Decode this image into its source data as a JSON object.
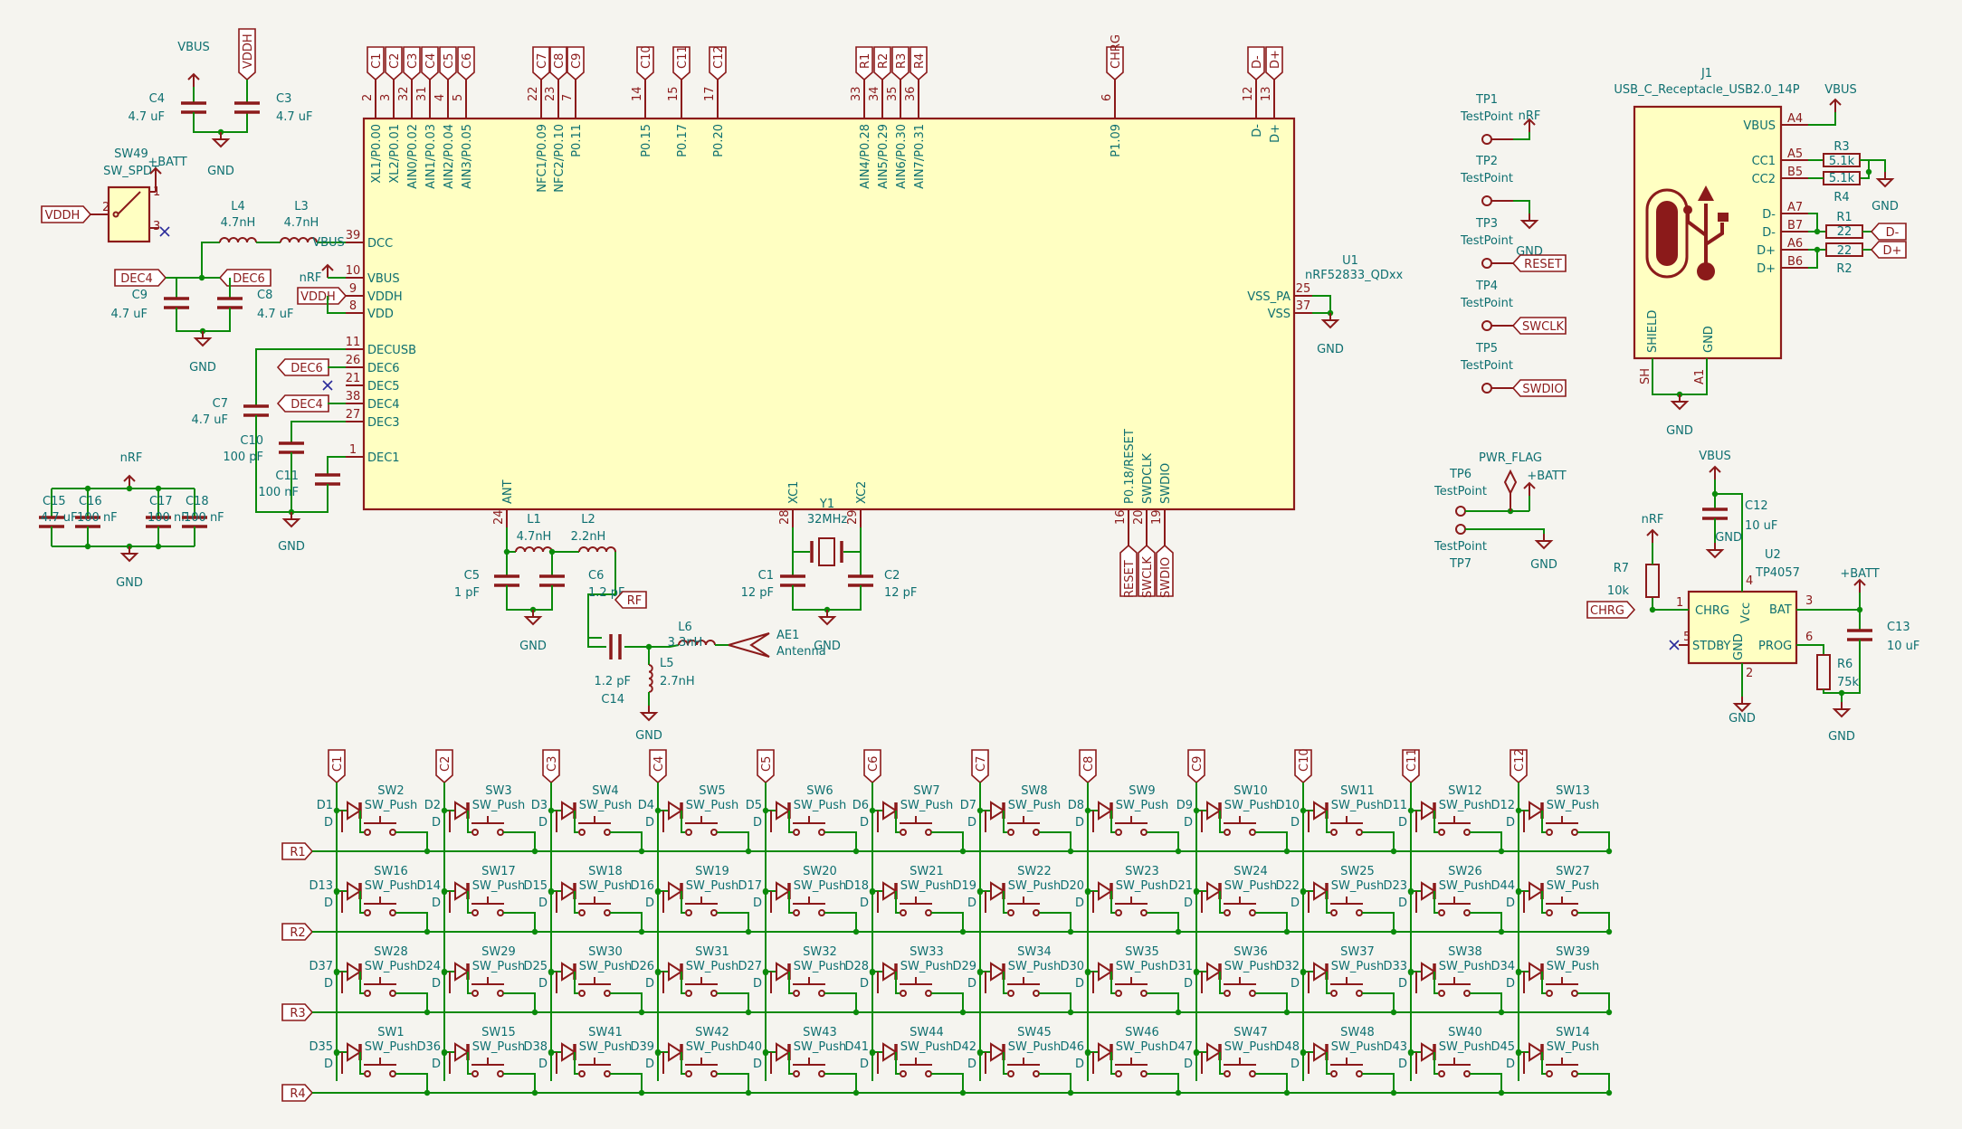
{
  "mcu": {
    "ref": "U1",
    "value": "nRF52833_QDxx",
    "top": [
      [
        "2",
        "XL1/P0.00",
        "C1"
      ],
      [
        "3",
        "XL2/P0.01",
        "C2"
      ],
      [
        "32",
        "AIN0/P0.02",
        "C3"
      ],
      [
        "31",
        "AIN1/P0.03",
        "C4"
      ],
      [
        "4",
        "AIN2/P0.04",
        "C5"
      ],
      [
        "5",
        "AIN3/P0.05",
        "C6"
      ],
      [
        "22",
        "NFC1/P0.09",
        "C7"
      ],
      [
        "23",
        "NFC2/P0.10",
        "C8"
      ],
      [
        "7",
        "P0.11",
        "C9"
      ],
      [
        "14",
        "P0.15",
        "C10"
      ],
      [
        "15",
        "P0.17",
        "C11"
      ],
      [
        "17",
        "P0.20",
        "C12"
      ],
      [
        "33",
        "AIN4/P0.28",
        "R1"
      ],
      [
        "34",
        "AIN5/P0.29",
        "R2"
      ],
      [
        "35",
        "AIN6/P0.30",
        "R3"
      ],
      [
        "36",
        "AIN7/P0.31",
        "R4"
      ],
      [
        "6",
        "P1.09",
        "CHRG"
      ],
      [
        "12",
        "D-",
        "D-"
      ],
      [
        "13",
        "D+",
        "D+"
      ]
    ],
    "left": [
      [
        "39",
        "DCC"
      ],
      [
        "10",
        "VBUS"
      ],
      [
        "9",
        "VDDH"
      ],
      [
        "8",
        "VDD"
      ],
      [
        "11",
        "DECUSB"
      ],
      [
        "26",
        "DEC6"
      ],
      [
        "21",
        "DEC5"
      ],
      [
        "38",
        "DEC4"
      ],
      [
        "27",
        "DEC3"
      ],
      [
        "1",
        "DEC1"
      ]
    ],
    "right": [
      [
        "25",
        "VSS_PA"
      ],
      [
        "37",
        "VSS"
      ]
    ],
    "bottom": [
      [
        "24",
        "ANT"
      ],
      [
        "28",
        "XC1"
      ],
      [
        "29",
        "XC2"
      ],
      [
        "16",
        "P0.18/RESET"
      ],
      [
        "20",
        "SWDCLK"
      ],
      [
        "19",
        "SWDIO"
      ]
    ],
    "swd_labels": [
      "RESET",
      "SWCLK",
      "SWDIO"
    ]
  },
  "power": {
    "C4": "C4",
    "C4v": "4.7 uF",
    "C3": "C3",
    "C3v": "4.7 uF",
    "vbus": "VBUS",
    "vddh": "VDDH",
    "gnd": "GND"
  },
  "switch": {
    "ref": "SW49",
    "value": "SW_SPDT",
    "batt": "+BATT",
    "vddh": "VDDH",
    "p1": "1",
    "p2": "2",
    "p3": "3"
  },
  "dcdc": {
    "L4": "L4",
    "L4v": "4.7nH",
    "L3": "L3",
    "L3v": "4.7nH",
    "vbus": "VBUS",
    "nrf": "nRF",
    "vddh": "VDDH",
    "dec4": "DEC4",
    "dec6": "DEC6",
    "C9": "C9",
    "C9v": "4.7 uF",
    "C8": "C8",
    "C8v": "4.7 uF",
    "gnd": "GND"
  },
  "decoup": {
    "C7": "C7",
    "C7v": "4.7 uF",
    "C10": "C10",
    "C10v": "100 pF",
    "C11": "C11",
    "C11v": "100 nF",
    "dec6": "DEC6",
    "dec4": "DEC4",
    "gnd": "GND"
  },
  "bulk": {
    "net": "nRF",
    "gnd": "GND",
    "caps": [
      [
        "C15",
        "4.7 uF"
      ],
      [
        "C16",
        "100 nF"
      ],
      [
        "C17",
        "100 nF"
      ],
      [
        "C18",
        "100 nF"
      ]
    ]
  },
  "rf": {
    "L1": "L1",
    "L1v": "4.7nH",
    "L2": "L2",
    "L2v": "2.2nH",
    "C5": "C5",
    "C5v": "1 pF",
    "C6": "C6",
    "C6v": "1.2 pF",
    "rf": "RF",
    "C14": "C14",
    "C14v": "1.2 pF",
    "L6": "L6",
    "L6v": "3.3nH",
    "L5": "L5",
    "L5v": "2.7nH",
    "ant": "AE1",
    "antv": "Antenna",
    "gnd": "GND"
  },
  "xtal": {
    "Y1": "Y1",
    "Y1v": "32MHz",
    "C1": "C1",
    "C1v": "12 pF",
    "C2": "C2",
    "C2v": "12 pF",
    "gnd": "GND"
  },
  "testpoints": [
    [
      "TP1",
      "TestPoint",
      "nRF"
    ],
    [
      "TP2",
      "TestPoint",
      "GND"
    ],
    [
      "TP3",
      "TestPoint",
      "RESET"
    ],
    [
      "TP4",
      "TestPoint",
      "SWCLK"
    ],
    [
      "TP5",
      "TestPoint",
      "SWDIO"
    ]
  ],
  "pwrflag": {
    "tp6": "TP6",
    "tp6v": "TestPoint",
    "flag": "PWR_FLAG",
    "batt": "+BATT",
    "tp7": "TP7",
    "tp7v": "TestPoint",
    "gnd": "GND"
  },
  "usb": {
    "ref": "J1",
    "value": "USB_C_Receptacle_USB2.0_14P",
    "vbus": "VBUS",
    "gnd": "GND",
    "shield": "SHIELD",
    "gndpin": "GND",
    "sh": "SH",
    "a1": "A1",
    "pins": [
      [
        "A4",
        "VBUS"
      ],
      [
        "A5",
        "CC1"
      ],
      [
        "B5",
        "CC2"
      ],
      [
        "A7",
        "D-"
      ],
      [
        "B7",
        "D-"
      ],
      [
        "A6",
        "D+"
      ],
      [
        "B6",
        "D+"
      ]
    ],
    "R3": "R3",
    "R3v": "5.1k",
    "R4": "R4",
    "R4v": "5.1k",
    "R1": "R1",
    "R1v": "22",
    "R2": "R2",
    "R2v": "22",
    "dm": "D-",
    "dp": "D+"
  },
  "charger": {
    "ref": "U2",
    "value": "TP4057",
    "vbus": "VBUS",
    "C12": "C12",
    "C12v": "10 uF",
    "nrf": "nRF",
    "R7": "R7",
    "R7v": "10k",
    "chrg": "CHRG",
    "batt": "+BATT",
    "C13": "C13",
    "C13v": "10 uF",
    "R6": "R6",
    "R6v": "75k",
    "gnd": "GND",
    "pins": {
      "chrg": "CHRG",
      "vcc": "Vcc",
      "bat": "BAT",
      "stdby": "STDBY",
      "gnd": "GND",
      "prog": "PROG",
      "p1": "1",
      "p4": "4",
      "p3": "3",
      "p5": "5",
      "p2": "2",
      "p6": "6"
    }
  },
  "matrix": {
    "cols": [
      "C1",
      "C2",
      "C3",
      "C4",
      "C5",
      "C6",
      "C7",
      "C8",
      "C9",
      "C10",
      "C11",
      "C12"
    ],
    "rows": [
      "R1",
      "R2",
      "R3",
      "R4"
    ],
    "sw": [
      [
        "SW2",
        "SW3",
        "SW4",
        "SW5",
        "SW6",
        "SW7",
        "SW8",
        "SW9",
        "SW10",
        "SW11",
        "SW12",
        "SW13"
      ],
      [
        "SW16",
        "SW17",
        "SW18",
        "SW19",
        "SW20",
        "SW21",
        "SW22",
        "SW23",
        "SW24",
        "SW25",
        "SW26",
        "SW27"
      ],
      [
        "SW28",
        "SW29",
        "SW30",
        "SW31",
        "SW32",
        "SW33",
        "SW34",
        "SW35",
        "SW36",
        "SW37",
        "SW38",
        "SW39"
      ],
      [
        "SW1",
        "SW15",
        "SW41",
        "SW42",
        "SW43",
        "SW44",
        "SW45",
        "SW46",
        "SW47",
        "SW48",
        "SW40",
        "SW14"
      ]
    ],
    "d": [
      [
        "D1",
        "D2",
        "D3",
        "D4",
        "D5",
        "D6",
        "D7",
        "D8",
        "D9",
        "D10",
        "D11",
        "D12"
      ],
      [
        "D13",
        "D14",
        "D15",
        "D16",
        "D17",
        "D18",
        "D19",
        "D20",
        "D21",
        "D22",
        "D23",
        "D44"
      ],
      [
        "D37",
        "D24",
        "D25",
        "D26",
        "D27",
        "D28",
        "D29",
        "D30",
        "D31",
        "D32",
        "D33",
        "D34"
      ],
      [
        "D35",
        "D36",
        "D38",
        "D39",
        "D40",
        "D41",
        "D42",
        "D46",
        "D47",
        "D48",
        "D43",
        "D45"
      ]
    ],
    "swval": "SW_Push",
    "dval": "D"
  }
}
